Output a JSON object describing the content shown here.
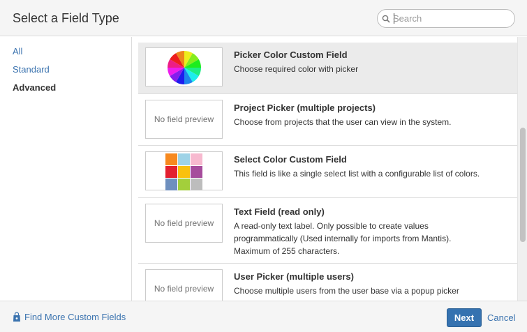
{
  "dialog": {
    "title": "Select a Field Type"
  },
  "search": {
    "placeholder": "Search",
    "value": ""
  },
  "sidebar": {
    "items": [
      {
        "label": "All",
        "active": false
      },
      {
        "label": "Standard",
        "active": false
      },
      {
        "label": "Advanced",
        "active": true
      }
    ]
  },
  "fields": [
    {
      "title": "Picker Color Custom Field",
      "description": "Choose required color with picker",
      "preview": "color-wheel-image",
      "selected": true
    },
    {
      "title": "Project Picker (multiple projects)",
      "description": "Choose from projects that the user can view in the system.",
      "preview_text": "No field preview",
      "selected": false
    },
    {
      "title": "Select Color Custom Field",
      "description": "This field is like a single select list with a configurable list of colors.",
      "preview": "color-grid-image",
      "selected": false,
      "grid_colors": [
        "#f7891f",
        "#9ed3e7",
        "#f7b9cf",
        "#e32030",
        "#f9c10e",
        "#a64c9c",
        "#6e8fbe",
        "#a3cf3b",
        "#bdbdbd"
      ]
    },
    {
      "title": "Text Field (read only)",
      "description_lines": [
        "A read-only text label. Only possible to create values",
        "programmatically (Used internally for imports from Mantis).",
        "Maximum of 255 characters."
      ],
      "preview_text": "No field preview",
      "selected": false
    },
    {
      "title": "User Picker (multiple users)",
      "description": "Choose multiple users from the user base via a popup picker",
      "preview_text": "No field preview",
      "selected": false
    }
  ],
  "footer": {
    "more_link_label": "Find More Custom Fields",
    "more_link_icon": "shopping-bag-icon",
    "next_label": "Next",
    "cancel_label": "Cancel"
  },
  "colors": {
    "link": "#3b73af",
    "primary_button": "#3572b0",
    "selected_row": "#ebebeb"
  }
}
